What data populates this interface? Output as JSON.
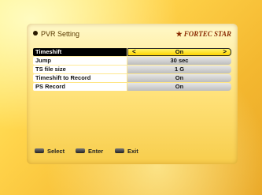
{
  "header": {
    "title": "PVR Setting",
    "brand": "FORTEC STAR"
  },
  "menu": {
    "items": [
      {
        "label": "Timeshift",
        "value": "On"
      },
      {
        "label": "Jump",
        "value": "30 sec"
      },
      {
        "label": "TS file size",
        "value": "1 G"
      },
      {
        "label": "Timeshift to Record",
        "value": "On"
      },
      {
        "label": "PS Record",
        "value": "On"
      }
    ],
    "arrow_left": "<",
    "arrow_right": ">"
  },
  "footer": {
    "select": "Select",
    "enter": "Enter",
    "exit": "Exit"
  },
  "colors": {
    "active_label_bg": "#000000",
    "active_value_bg": "#ffe11a",
    "brand": "#8a2a00"
  },
  "icons": {
    "bullet": "bullet-icon",
    "star": "star-icon"
  }
}
